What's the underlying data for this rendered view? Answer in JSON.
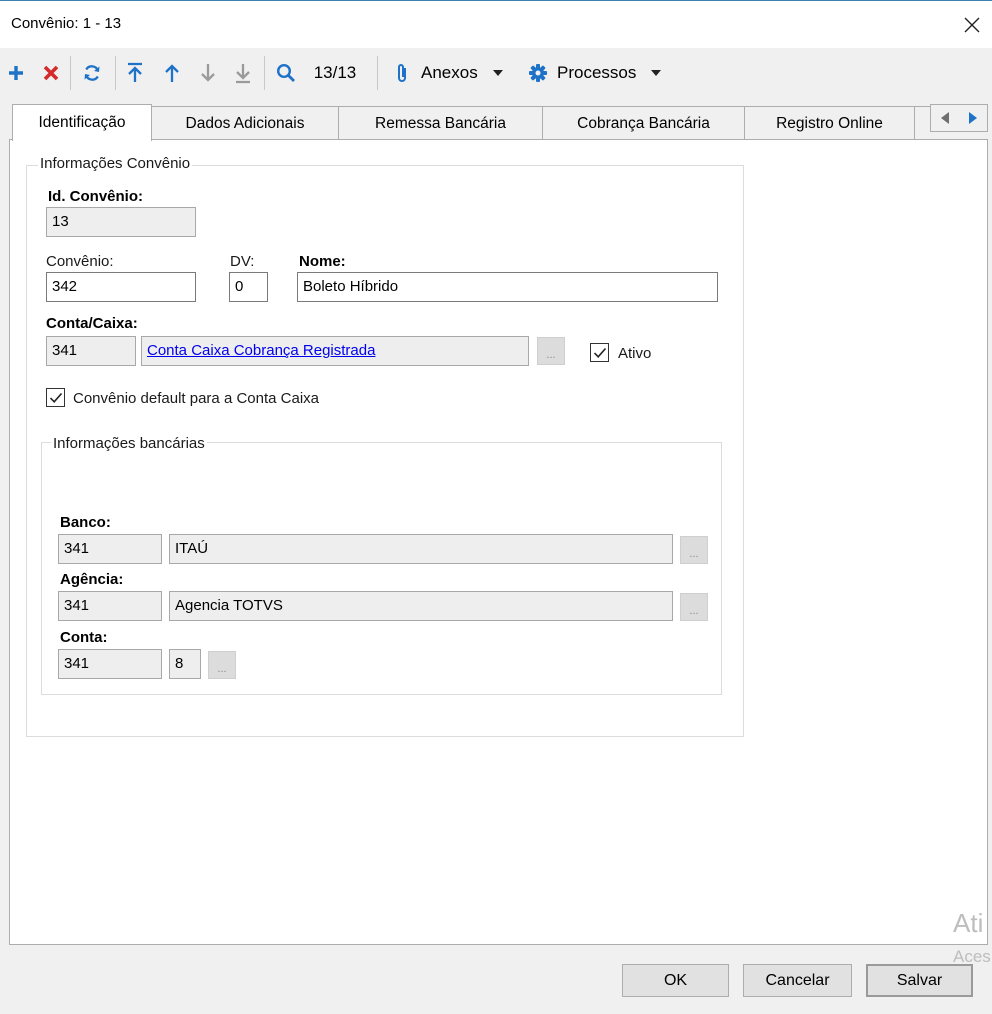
{
  "window": {
    "title": "Convênio: 1 - 13"
  },
  "toolbar": {
    "record_counter": "13/13",
    "anexos_label": "Anexos",
    "processos_label": "Processos"
  },
  "tabs": [
    {
      "label": "Identificação",
      "active": true
    },
    {
      "label": "Dados Adicionais",
      "active": false
    },
    {
      "label": "Remessa Bancária",
      "active": false
    },
    {
      "label": "Cobrança Bancária",
      "active": false
    },
    {
      "label": "Registro Online",
      "active": false
    }
  ],
  "convenio_group": {
    "legend": "Informações Convênio",
    "id_label": "Id. Convênio:",
    "id_value": "13",
    "convenio_label": "Convênio:",
    "convenio_value": "342",
    "dv_label": "DV:",
    "dv_value": "0",
    "nome_label": "Nome:",
    "nome_value": "Boleto Híbrido",
    "conta_caixa_label": "Conta/Caixa:",
    "conta_caixa_code": "341",
    "conta_caixa_name": "Conta Caixa Cobrança Registrada",
    "ellipsis": "...",
    "ativo_label": "Ativo",
    "ativo_checked": true,
    "default_label": "Convênio default para a Conta Caixa",
    "default_checked": true
  },
  "bank_group": {
    "legend": "Informações bancárias",
    "banco_label": "Banco:",
    "banco_code": "341",
    "banco_name": "ITAÚ",
    "agencia_label": "Agência:",
    "agencia_code": "341",
    "agencia_name": "Agencia TOTVS",
    "conta_label": "Conta:",
    "conta_code": "341",
    "conta_digit": "8",
    "ellipsis": "..."
  },
  "buttons": {
    "ok": "OK",
    "cancel": "Cancelar",
    "save": "Salvar"
  },
  "watermark": {
    "line1": "Ati",
    "line2": "Aces"
  },
  "colors": {
    "accent_blue": "#1e72c8",
    "delete_red": "#d42a2a",
    "link_blue": "#0000ee"
  }
}
